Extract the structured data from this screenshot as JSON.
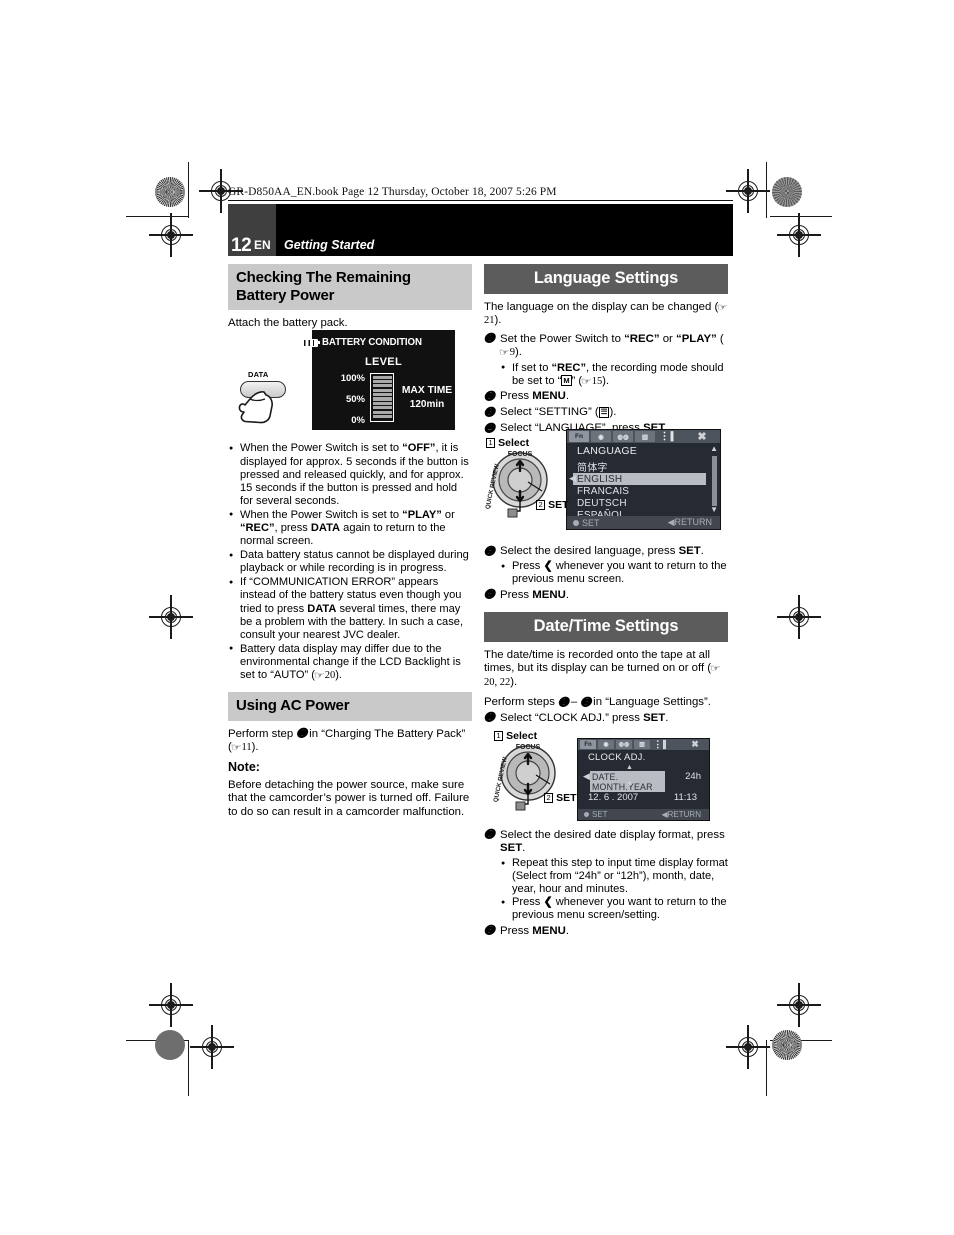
{
  "header": {
    "file_line": "GR-D850AA_EN.book  Page 12  Thursday, October 18, 2007  5:26 PM",
    "page_number": "12",
    "lang_code": "EN",
    "chapter": "Getting Started"
  },
  "left_column": {
    "section1_title": "Checking The Remaining Battery Power",
    "intro": "Attach the battery pack.",
    "data_button_label": "DATA",
    "battery_lcd": {
      "title": "BATTERY CONDITION",
      "level_label": "LEVEL",
      "pct_100": "100%",
      "pct_50": "50%",
      "pct_0": "0%",
      "max_time_label": "MAX TIME",
      "max_time_value": "120min",
      "segments": 10
    },
    "bullets": [
      "When the Power Switch is set to “OFF”, it is displayed for approx. 5 seconds if the button is pressed and released quickly, and for approx. 15 seconds if the button is pressed and hold for several seconds.",
      "When the Power Switch is set to “PLAY” or “REC”, press DATA again to return to the normal screen.",
      "Data battery status cannot be displayed during playback or while recording is in progress.",
      "If “COMMUNICATION ERROR” appears instead of the battery status even though you tried to press DATA several times, there may be a problem with the battery. In such a case, consult your nearest JVC dealer.",
      "Battery data display may differ due to the environmental change if the LCD Backlight is set to “AUTO” (☞ 20)."
    ],
    "section2_title": "Using AC Power",
    "ac_text": "Perform step ③ in “Charging The Battery Pack” (☞ 11).",
    "note_label": "Note:",
    "note_text": "Before detaching the power source, make sure that the camcorder’s power is turned off. Failure to do so can result in a camcorder malfunction."
  },
  "right_column": {
    "section1_title": "Language Settings",
    "intro": "The language on the display can be changed (☞ 21).",
    "steps": [
      {
        "num": "1",
        "text": "Set the Power Switch to “REC” or “PLAY” (☞ 9).",
        "subs": [
          "If set to “REC”, the recording mode should be set to “M” (☞ 15)."
        ]
      },
      {
        "num": "2",
        "text": "Press MENU.",
        "subs": []
      },
      {
        "num": "3",
        "text": "Select “SETTING” (icon).",
        "subs": []
      },
      {
        "num": "4",
        "text": "Select “LANGUAGE”, press SET.",
        "subs": []
      }
    ],
    "language_lcd": {
      "top_icons": [
        "Fn",
        "camera",
        "tape",
        "effects",
        "setting",
        "exit"
      ],
      "title": "LANGUAGE",
      "items": [
        "简体字",
        "ENGLISH",
        "FRANCAIS",
        "DEUTSCH",
        "ESPAÑOL"
      ],
      "selected": "ENGLISH",
      "footer_left": "SET",
      "footer_right": "RETURN"
    },
    "dial1": {
      "select_label": "Select",
      "select_num": "1",
      "set_label": "SET",
      "set_num": "2",
      "focus_text": "FOCUS"
    },
    "steps_after": [
      {
        "num": "5",
        "text": "Select the desired language, press SET.",
        "subs": [
          "Press ❮ whenever you want to return to the previous menu screen."
        ]
      },
      {
        "num": "6",
        "text": "Press MENU.",
        "subs": []
      }
    ],
    "section2_title": "Date/Time Settings",
    "dt_intro": "The date/time is recorded onto the tape at all times, but its display can be turned on or off (☞ 20, 22).",
    "dt_perform": "Perform steps ① – ③ in “Language Settings”.",
    "dt_steps1": [
      {
        "num": "1",
        "text": "Select “CLOCK ADJ.” press SET.",
        "subs": []
      }
    ],
    "clock_lcd": {
      "title": "CLOCK  ADJ.",
      "format_row": "DATE. MONTH.YEAR",
      "time_mode": "24h",
      "date_value": "12.   6 . 2007",
      "time_value": "11:13",
      "footer_left": "SET",
      "footer_right": "RETURN"
    },
    "dial2": {
      "select_label": "Select",
      "select_num": "1",
      "set_label": "SET",
      "set_num": "2",
      "focus_text": "FOCUS"
    },
    "dt_steps2": [
      {
        "num": "2",
        "text": "Select the desired date display format, press SET.",
        "subs": [
          "Repeat this step to input time display format (Select from “24h” or “12h”), month, date, year, hour and minutes.",
          "Press ❮ whenever you want to return to the previous menu screen/setting."
        ]
      },
      {
        "num": "3",
        "text": "Press MENU.",
        "subs": []
      }
    ]
  }
}
